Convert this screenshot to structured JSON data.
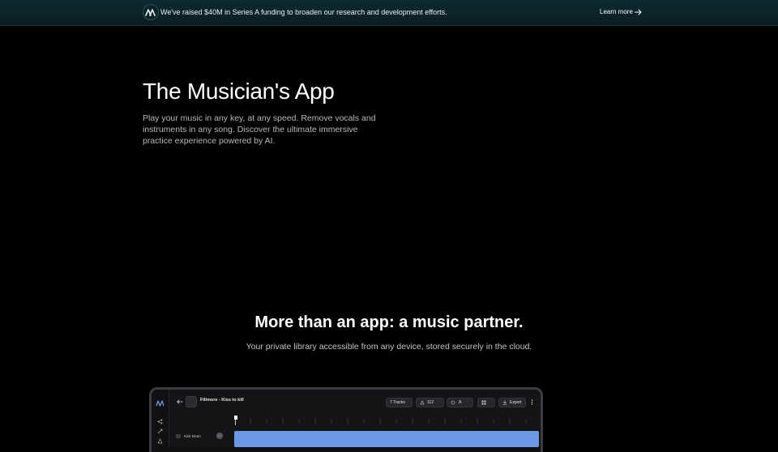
{
  "banner": {
    "message": "We've raised $40M in Series A funding to broaden our research and development efforts.",
    "cta": "Learn more",
    "logo_icon": "moises-logo-icon",
    "arrow_icon": "arrow-right-icon"
  },
  "hero": {
    "title": "The Musician's App",
    "description": "Play your music in any key, at any speed. Remove vocals and instruments in any song. Discover the ultimate immersive practice experience powered by AI."
  },
  "section": {
    "title": "More than an app: a music partner.",
    "subtitle": "Your private library accessible from any device, stored securely in the cloud."
  },
  "app_preview": {
    "song_title": "Fillmore - Kiss to kill",
    "tracks_label": "7 Tracks",
    "bpm_value": "112",
    "key_value": "A",
    "export_label": "Export",
    "track_name": "Kick Drum",
    "accent_color": "#6d98e8"
  }
}
